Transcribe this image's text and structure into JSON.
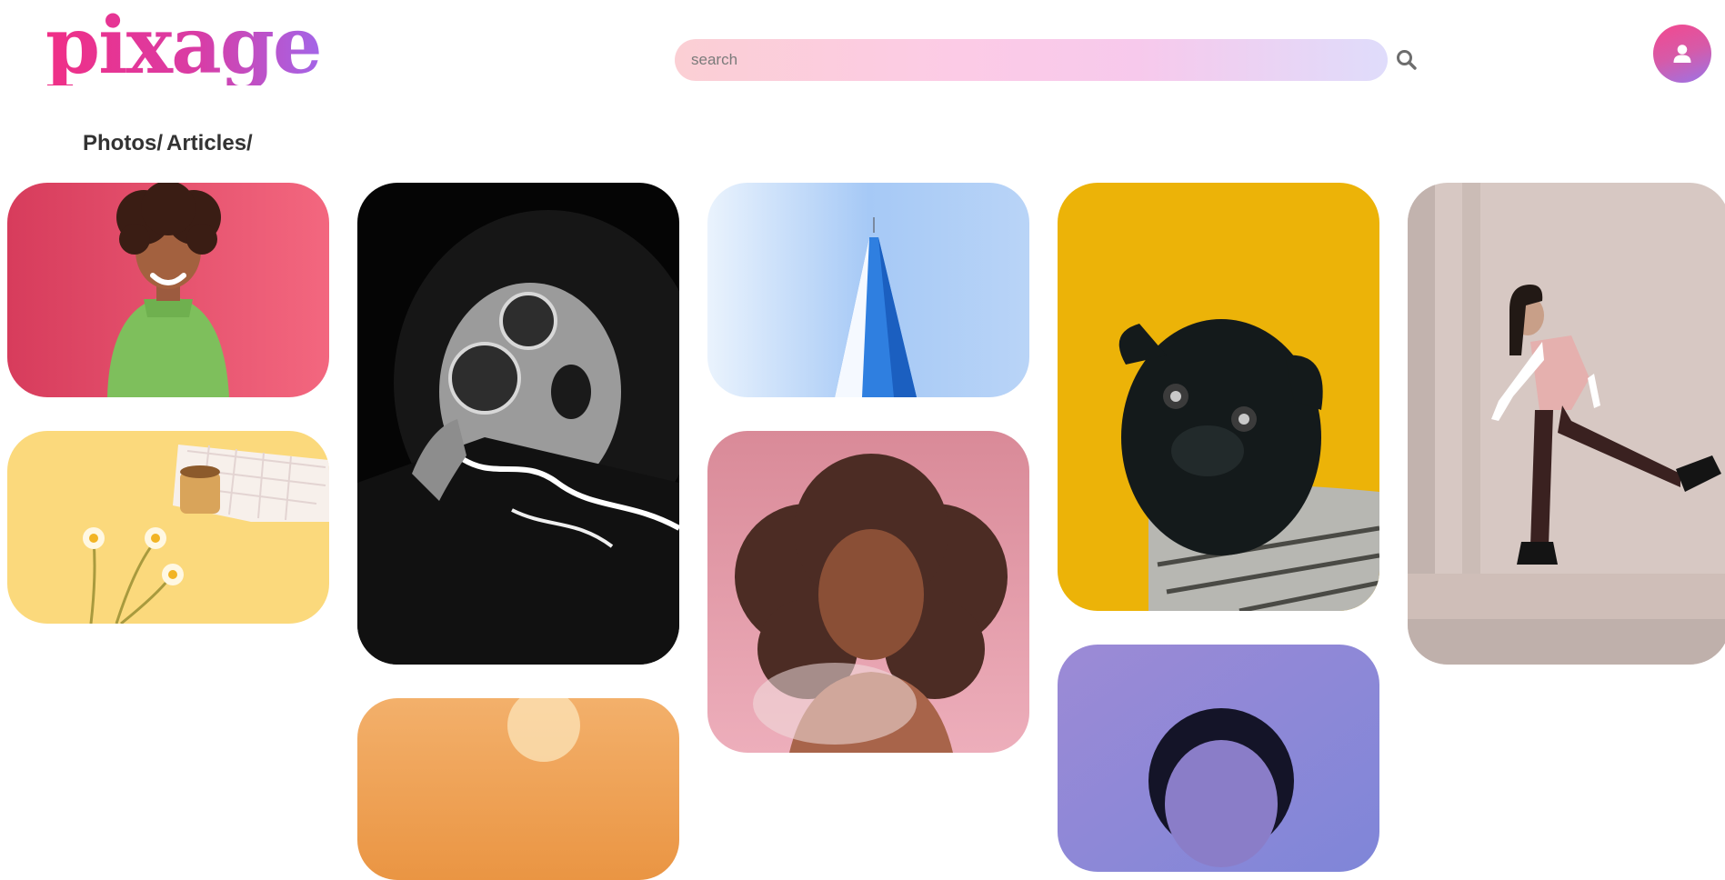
{
  "brand": {
    "logo_text": "pixage"
  },
  "search": {
    "placeholder": "search",
    "value": "",
    "icon": "search-icon"
  },
  "user": {
    "icon": "user-icon"
  },
  "nav": {
    "photos_label": "Photos",
    "articles_label": "Articles",
    "separator": "/"
  },
  "colors": {
    "brand_pink": "#f02f86",
    "brand_purple": "#a365e8",
    "search_gradient_start": "#fbcfd4",
    "search_gradient_end": "#dfdcfb",
    "text_dark": "#333333"
  },
  "gallery": {
    "columns": [
      {
        "photos": [
          "smiling-woman-green-sweater",
          "coffee-cup-daisies-yellow"
        ]
      },
      {
        "photos": [
          "woman-sunglasses-black-white",
          "orange-sunset-landscape"
        ]
      },
      {
        "photos": [
          "skyscraper-blue-sky",
          "woman-curly-hair-pink"
        ]
      },
      {
        "photos": [
          "pug-knit-scarf-yellow",
          "woman-purple-backdrop"
        ]
      },
      {
        "photos": [
          "woman-walking-kick-street"
        ]
      }
    ]
  }
}
